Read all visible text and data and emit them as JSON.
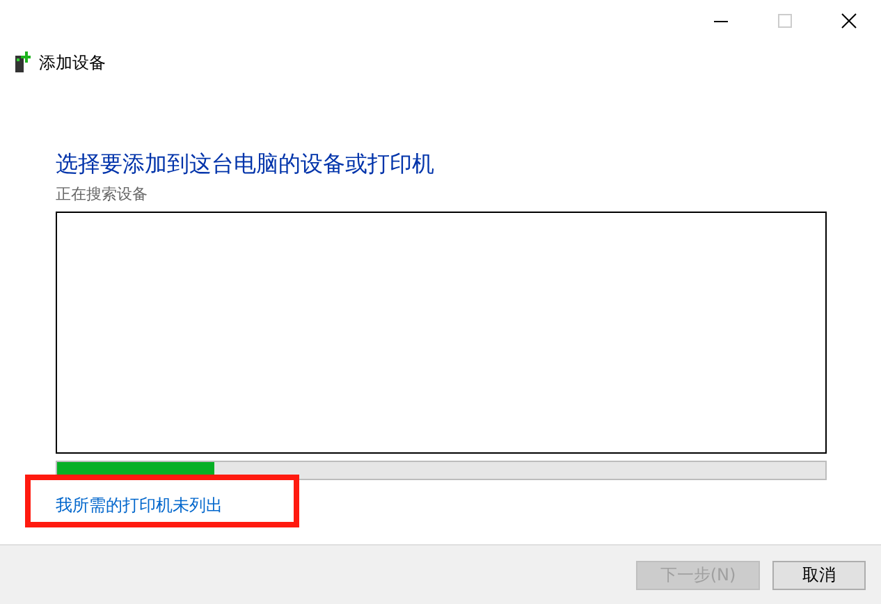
{
  "window": {
    "title": "添加设备",
    "maximize_disabled": true
  },
  "heading": "选择要添加到这台电脑的设备或打印机",
  "status": "正在搜索设备",
  "progress": {
    "level": 0.204
  },
  "link": {
    "label": "我所需的打印机未列出",
    "highlighted": true
  },
  "buttons": [
    {
      "label": "下一步(N)",
      "disabled": true
    },
    {
      "label": "取消",
      "disabled": false
    }
  ]
}
